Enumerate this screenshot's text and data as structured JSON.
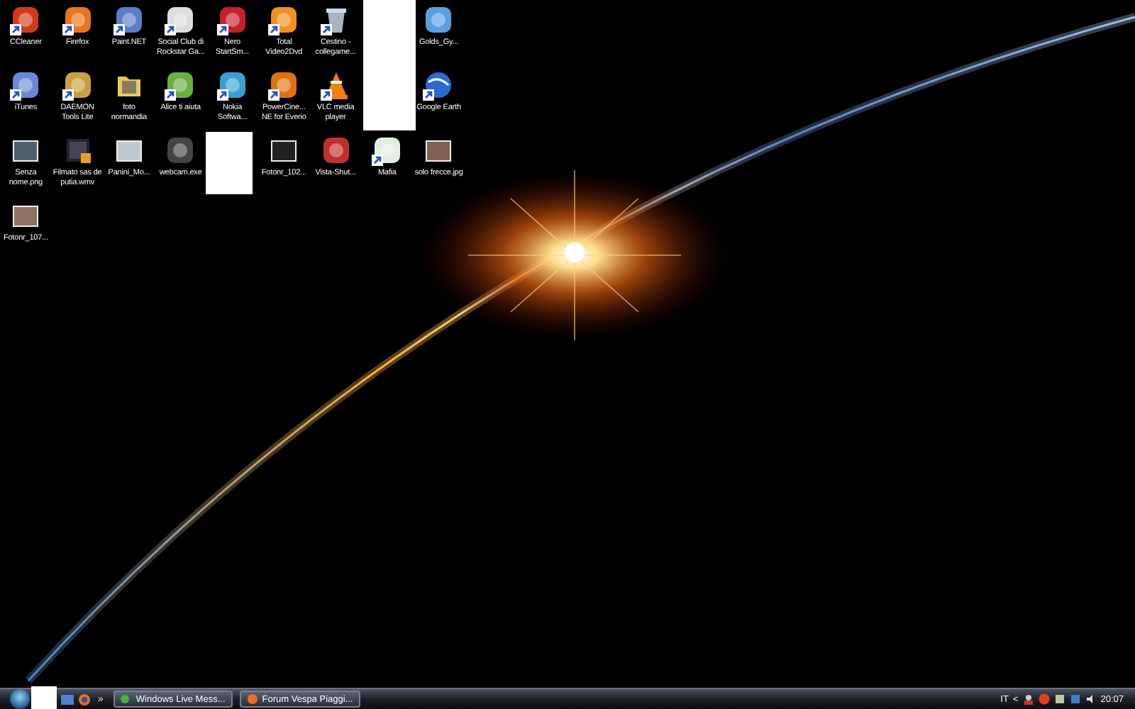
{
  "desktop_icons": [
    {
      "kind": "app",
      "label": "CCleaner",
      "shortcut": true
    },
    {
      "kind": "app",
      "label": "Firefox",
      "shortcut": true
    },
    {
      "kind": "app",
      "label": "Paint.NET",
      "shortcut": true
    },
    {
      "kind": "app",
      "label": "Social Club di Rockstar Ga...",
      "shortcut": true
    },
    {
      "kind": "app",
      "label": "Nero StartSm...",
      "shortcut": true
    },
    {
      "kind": "app",
      "label": "Total Video2Dvd",
      "shortcut": true
    },
    {
      "kind": "bin",
      "label": "Cestino - collegame...",
      "shortcut": true
    },
    {
      "kind": "blank",
      "tall": true
    },
    {
      "kind": "app",
      "label": "Golds_Gy...",
      "shortcut": false
    },
    {
      "kind": "app",
      "label": "iTunes",
      "shortcut": true
    },
    {
      "kind": "app",
      "label": "DAEMON Tools Lite",
      "shortcut": true
    },
    {
      "kind": "folder",
      "label": "foto normandia",
      "shortcut": false
    },
    {
      "kind": "app",
      "label": "Alice ti aiuta",
      "shortcut": true
    },
    {
      "kind": "app",
      "label": "Nokia Softwa...",
      "shortcut": true
    },
    {
      "kind": "app",
      "label": "PowerCine... NE for Everio",
      "shortcut": true
    },
    {
      "kind": "cone",
      "label": "VLC media player",
      "shortcut": true
    },
    {
      "kind": "globe",
      "label": "Google Earth",
      "shortcut": true
    },
    {
      "kind": "image",
      "label": "Senza nome.png",
      "shortcut": false
    },
    {
      "kind": "video",
      "label": "Filmato sas de putia.wmv",
      "shortcut": false
    },
    {
      "kind": "image",
      "label": "Panini_Mo...",
      "shortcut": false
    },
    {
      "kind": "app",
      "label": "webcam.exe",
      "shortcut": false
    },
    {
      "kind": "blank",
      "tall": false
    },
    {
      "kind": "image",
      "label": "Fotonr_102...",
      "shortcut": false
    },
    {
      "kind": "app",
      "label": "Vista-Shut...",
      "shortcut": false
    },
    {
      "kind": "app",
      "label": "Mafia",
      "shortcut": true
    },
    {
      "kind": "image",
      "label": "solo frecce.jpg",
      "shortcut": false
    },
    {
      "kind": "image",
      "label": "Fotonr_107...",
      "shortcut": false
    }
  ],
  "taskbar": {
    "chevron": "»",
    "tasks": [
      {
        "label": "Windows Live Mess..."
      },
      {
        "label": "Forum Vespa Piaggi..."
      }
    ],
    "tray": {
      "language": "IT",
      "expand": "<",
      "clock": "20:07"
    }
  }
}
